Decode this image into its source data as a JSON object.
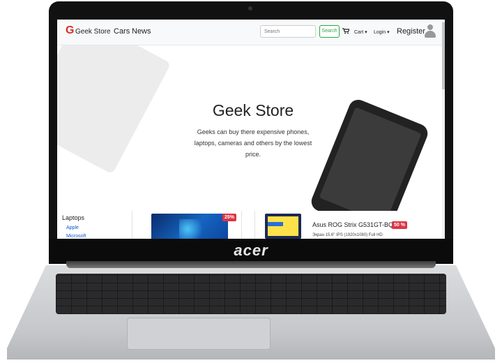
{
  "device": {
    "brand": "acer"
  },
  "navbar": {
    "brand_logo": "G",
    "brand": "Geek Store",
    "links": [
      "Cars",
      "News"
    ],
    "search": {
      "placeholder": "Search",
      "button": "Search"
    },
    "cart": "Cart ▾",
    "login": "Login ▾",
    "register": "Register"
  },
  "hero": {
    "title": "Geek Store",
    "text": "Geeks can buy there expensive phones, laptops, cameras and others by the lowest price."
  },
  "sidebar": {
    "title": "Laptops",
    "links": [
      "Apple",
      "Microsoft"
    ]
  },
  "products": [
    {
      "discount": "25%"
    },
    {
      "title": "Asus ROG Strix G531GT-BQ027",
      "discount": "50 %",
      "spec": "Экран 15.6\" IPS (1920x1080) Full HD"
    }
  ],
  "colors": {
    "success": "#28a745",
    "danger": "#dc3545",
    "brand_logo": "#d93025",
    "link": "#0a58ca"
  },
  "icons": {
    "cart": "cart-icon",
    "avatar": "user-avatar-icon"
  }
}
